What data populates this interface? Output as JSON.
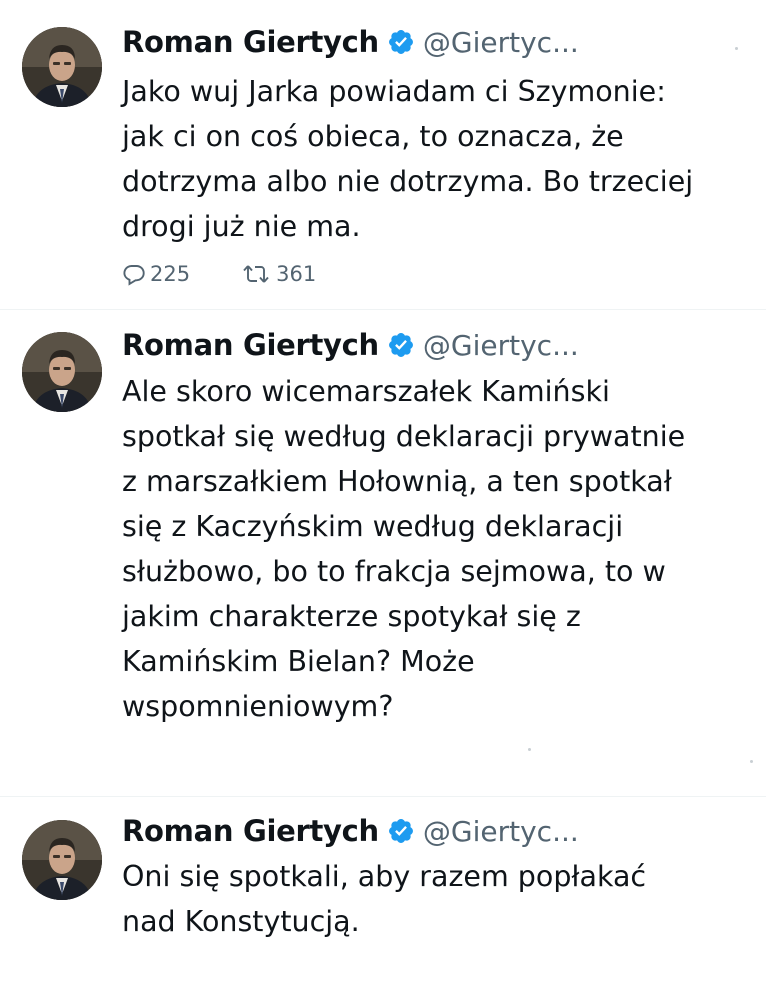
{
  "tweets": [
    {
      "name": "Roman Giertych",
      "handle": "@Giertyc...",
      "text": "Jako wuj Jarka powiadam ci Szymonie:\njak ci on coś obieca, to oznacza, że\ndotrzyma albo nie dotrzyma. Bo trzeciej\ndrogi już nie ma.",
      "replies": "225",
      "reposts": "361"
    },
    {
      "name": "Roman Giertych",
      "handle": "@Giertyc...",
      "text": "Ale skoro wicemarszałek Kamiński\nspotkał się według deklaracji prywatnie\nz marszałkiem Hołownią, a ten spotkał\nsię z Kaczyńskim według deklaracji\nsłużbowo, bo to frakcja sejmowa, to w\njakim charakterze spotykał się z\nKamińskim Bielan? Może\nwspomnieniowym?"
    },
    {
      "name": "Roman Giertych",
      "handle": "@Giertyc...",
      "text": "Oni się spotkali, aby razem popłakać\nnad Konstytucją."
    }
  ],
  "icons": {
    "verified": "verified-badge-icon",
    "reply": "reply-icon",
    "repost": "repost-icon"
  },
  "colors": {
    "verified": "#1d9bf0",
    "text": "#0f1419",
    "muted": "#536471"
  }
}
